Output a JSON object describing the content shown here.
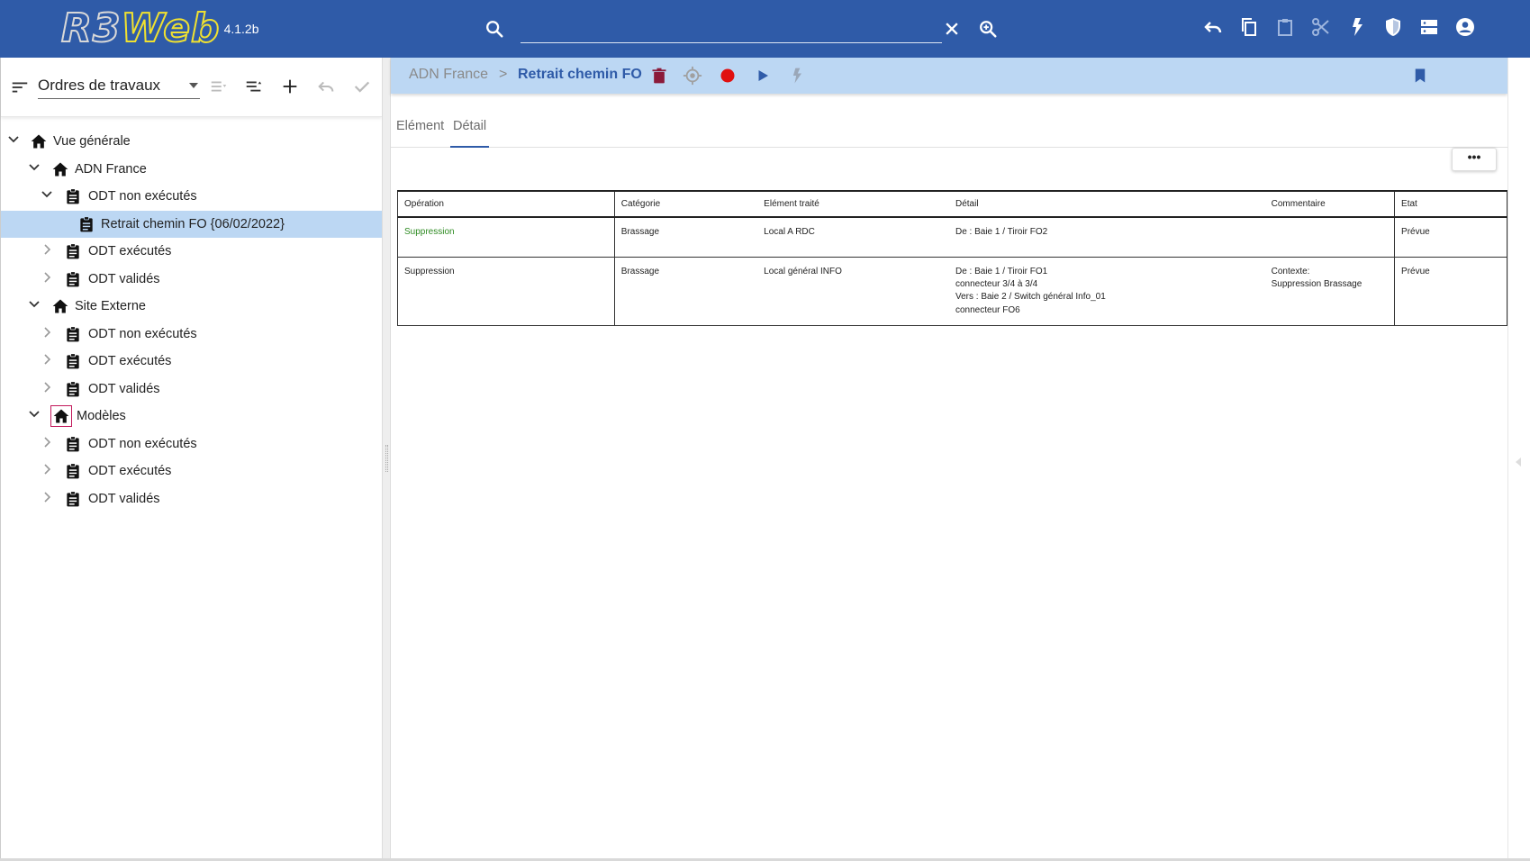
{
  "app": {
    "logo_text_r3": "R3",
    "logo_text_web": "Web",
    "version": "4.1.2b"
  },
  "topbar": {
    "search_value": "",
    "search_placeholder": "",
    "actions": [
      "undo-icon",
      "copy-icon",
      "paste-icon",
      "cut-icon",
      "flash-icon",
      "shield-icon",
      "dns-icon",
      "account-icon"
    ]
  },
  "left_panel": {
    "dropdown_value": "Ordres de travaux",
    "tree": {
      "root": "Vue générale",
      "site1": "ADN France",
      "site1_nonexec": "ODT non exécutés",
      "site1_selected": "Retrait chemin FO {06/02/2022}",
      "site1_exec": "ODT exécutés",
      "site1_valid": "ODT validés",
      "site2": "Site Externe",
      "site2_nonexec": "ODT non exécutés",
      "site2_exec": "ODT exécutés",
      "site2_valid": "ODT validés",
      "site3": "Modèles",
      "site3_nonexec": "ODT non exécutés",
      "site3_exec": "ODT exécutés",
      "site3_valid": "ODT validés"
    }
  },
  "right_panel": {
    "breadcrumb_root": "ADN France",
    "breadcrumb_sep": ">",
    "breadcrumb_current": "Retrait chemin FO",
    "tabs": [
      "Elément",
      "Détail"
    ],
    "active_tab": "Détail",
    "more_label": "•••",
    "table": {
      "headers": [
        "Opération",
        "Catégorie",
        "Elément traité",
        "Détail",
        "Commentaire",
        "Etat"
      ],
      "rows": [
        {
          "operation": "Suppression",
          "categorie": "Brassage",
          "element": "Local A RDC",
          "detail": [
            "De : Baie 1 / Tiroir FO2"
          ],
          "commentaire": [],
          "etat": "Prévue"
        },
        {
          "operation": "Suppression",
          "categorie": "Brassage",
          "element": "Local général INFO",
          "detail": [
            "De : Baie 1 / Tiroir FO1",
            "connecteur 3/4 à 3/4",
            "Vers : Baie 2 / Switch général Info_01",
            "connecteur FO6"
          ],
          "commentaire": [
            "Contexte:",
            "Suppression Brassage"
          ],
          "etat": "Prévue"
        }
      ]
    }
  },
  "colors": {
    "topbar": "#2f5ba8",
    "selection": "#bcd7f3",
    "delete": "#8b1a3a",
    "record": "#e01010",
    "play": "#2f5ba8",
    "bookmark": "#2f5ba8",
    "green_text": "#2e8b22"
  }
}
